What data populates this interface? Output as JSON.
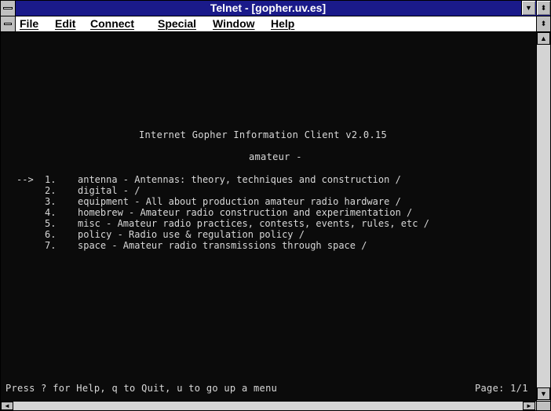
{
  "window": {
    "title": "Telnet - [gopher.uv.es]"
  },
  "titlebar_buttons": {
    "minimize_glyph": "▼",
    "maximize_glyph": "⬍"
  },
  "menu": {
    "items": [
      "File",
      "Edit",
      "Connect",
      "Special",
      "Window",
      "Help"
    ],
    "restore_glyph": "⬍"
  },
  "terminal": {
    "client_title": "Internet Gopher Information Client v2.0.15",
    "directory_title": "amateur",
    "selection_arrow": "-->",
    "entries": [
      {
        "num": "1.",
        "text": "antenna - Antennas: theory, techniques and construction /"
      },
      {
        "num": "2.",
        "text": "digital - /"
      },
      {
        "num": "3.",
        "text": "equipment - All about production amateur radio hardware /"
      },
      {
        "num": "4.",
        "text": "homebrew - Amateur radio construction and experimentation /"
      },
      {
        "num": "5.",
        "text": "misc - Amateur radio practices, contests, events, rules, etc /"
      },
      {
        "num": "6.",
        "text": "policy - Radio use & regulation policy /"
      },
      {
        "num": "7.",
        "text": "space - Amateur radio transmissions through space /"
      }
    ],
    "status_help": "Press ? for Help, q to Quit, u to go up a menu",
    "status_page": "Page: 1/1"
  },
  "scrollbars": {
    "up_glyph": "▲",
    "down_glyph": "▼",
    "left_glyph": "◄",
    "right_glyph": "►"
  }
}
